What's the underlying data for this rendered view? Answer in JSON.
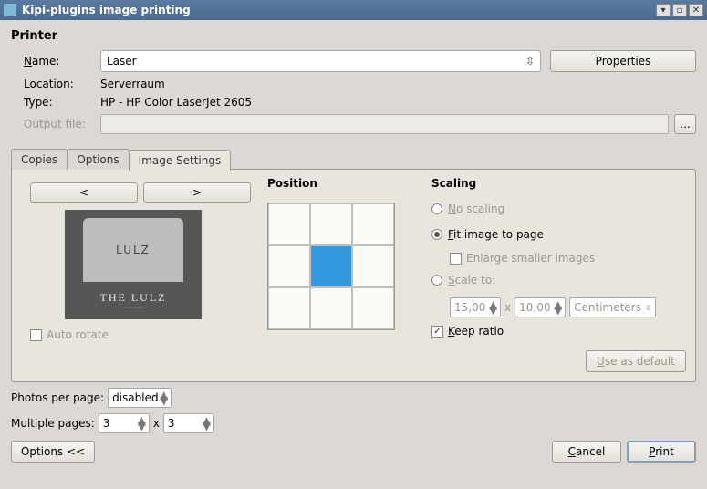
{
  "window": {
    "title": "Kipi-plugins image printing"
  },
  "printer": {
    "group_title": "Printer",
    "name_label": "Name:",
    "name_value": "Laser",
    "properties_label": "Properties",
    "location_label": "Location:",
    "location_value": "Serverraum",
    "type_label": "Type:",
    "type_value": "HP - HP Color LaserJet 2605",
    "output_label": "Output file:",
    "browse_label": "..."
  },
  "tabs": {
    "copies": "Copies",
    "options": "Options",
    "image_settings": "Image Settings"
  },
  "nav": {
    "prev": "<",
    "next": ">"
  },
  "preview": {
    "top": "LULZ",
    "caption": "THE LULZ"
  },
  "auto_rotate": "Auto rotate",
  "position": {
    "title": "Position"
  },
  "scaling": {
    "title": "Scaling",
    "no_scaling": "No scaling",
    "fit": "Fit image to page",
    "enlarge": "Enlarge smaller images",
    "scale_to": "Scale to:",
    "w": "15,00",
    "x": "x",
    "h": "10,00",
    "unit": "Centimeters",
    "keep_ratio": "Keep ratio",
    "use_default": "Use as default"
  },
  "photos_per_page": {
    "label": "Photos per page:",
    "value": "disabled"
  },
  "multiple_pages": {
    "label": "Multiple pages:",
    "a": "3",
    "x": "x",
    "b": "3"
  },
  "footer": {
    "options": "Options <<",
    "cancel": "Cancel",
    "print": "Print"
  }
}
